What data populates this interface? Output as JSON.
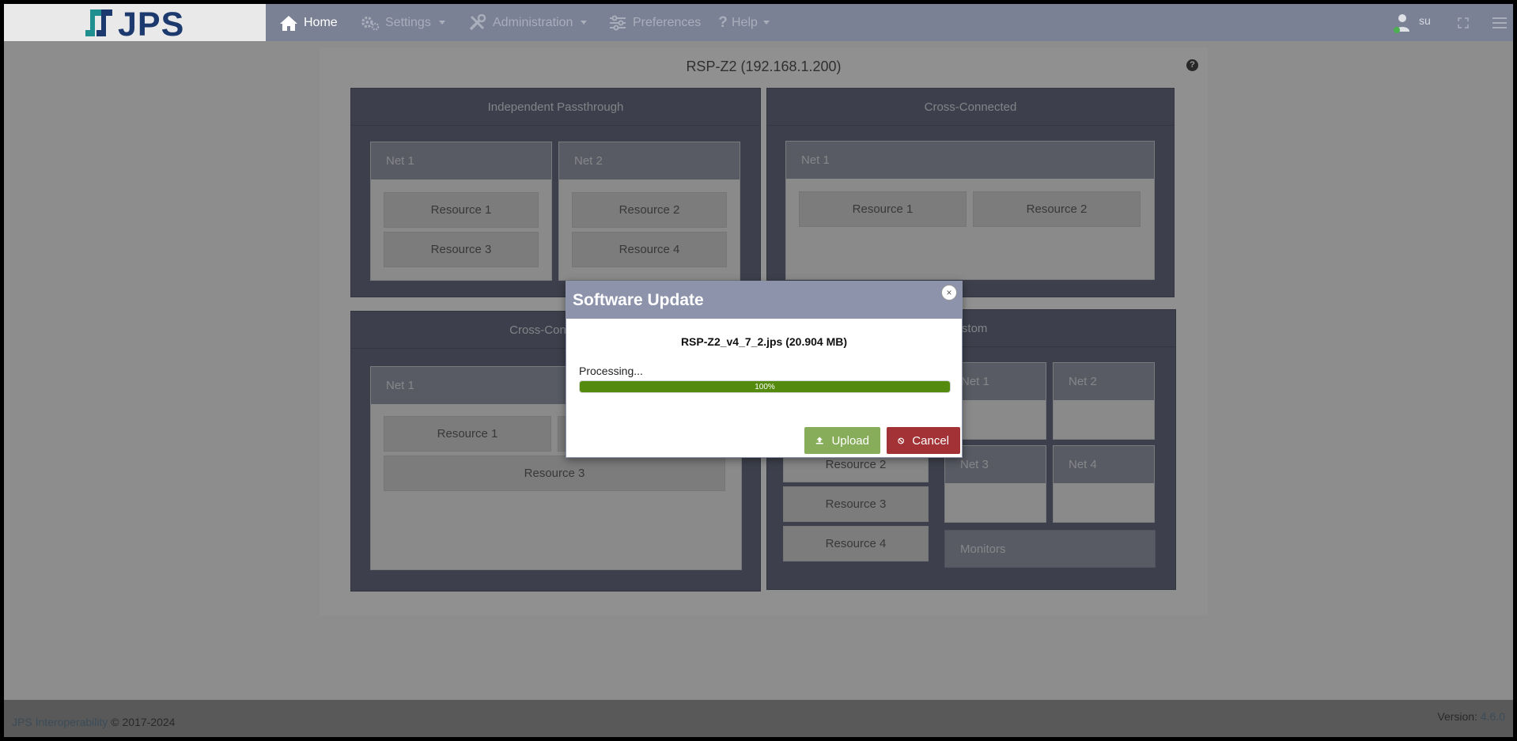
{
  "brand": {
    "logo_text": "JPS"
  },
  "nav": {
    "items": [
      {
        "label": "Home",
        "icon": "home-icon",
        "active": true
      },
      {
        "label": "Settings",
        "icon": "gears-icon"
      },
      {
        "label": "Administration",
        "icon": "tools-icon"
      },
      {
        "label": "Preferences",
        "icon": "sliders-icon"
      },
      {
        "label": "Help",
        "icon": "question-icon"
      }
    ],
    "user": "su"
  },
  "panel": {
    "title": "RSP-Z2 (192.168.1.200)",
    "help": "?",
    "groups": [
      {
        "title": "Independent Passthrough",
        "nets": [
          {
            "label": "Net 1",
            "resources": [
              "Resource 1",
              "Resource 3"
            ]
          },
          {
            "label": "Net 2",
            "resources": [
              "Resource 2",
              "Resource 4"
            ]
          }
        ]
      },
      {
        "title": "Cross-Connected",
        "nets": [
          {
            "label": "Net 1",
            "resources": [
              "Resource 1",
              "Resource 2"
            ]
          }
        ]
      },
      {
        "title": "Cross-Connected",
        "nets": [
          {
            "label": "Net 1",
            "resources": [
              "Resource 1",
              "Resource 3"
            ]
          }
        ]
      },
      {
        "title": "ustom",
        "resources": [
          "Resource 2",
          "Resource 3",
          "Resource 4"
        ],
        "nets": [
          {
            "label": "Net 1"
          },
          {
            "label": "Net 2"
          },
          {
            "label": "Net 3"
          },
          {
            "label": "Net 4"
          }
        ],
        "monitors": "Monitors"
      }
    ]
  },
  "modal": {
    "title": "Software Update",
    "close": "×",
    "file": "RSP-Z2_v4_7_2.jps (20.904 MB)",
    "status": "Processing...",
    "progress_percent": 100,
    "progress_label": "100%",
    "upload_label": "Upload",
    "cancel_label": "Cancel"
  },
  "footer": {
    "company": "JPS Interoperability",
    "copyright": " © 2017-2024",
    "version_label": "Version: ",
    "version": "4.6.0"
  }
}
